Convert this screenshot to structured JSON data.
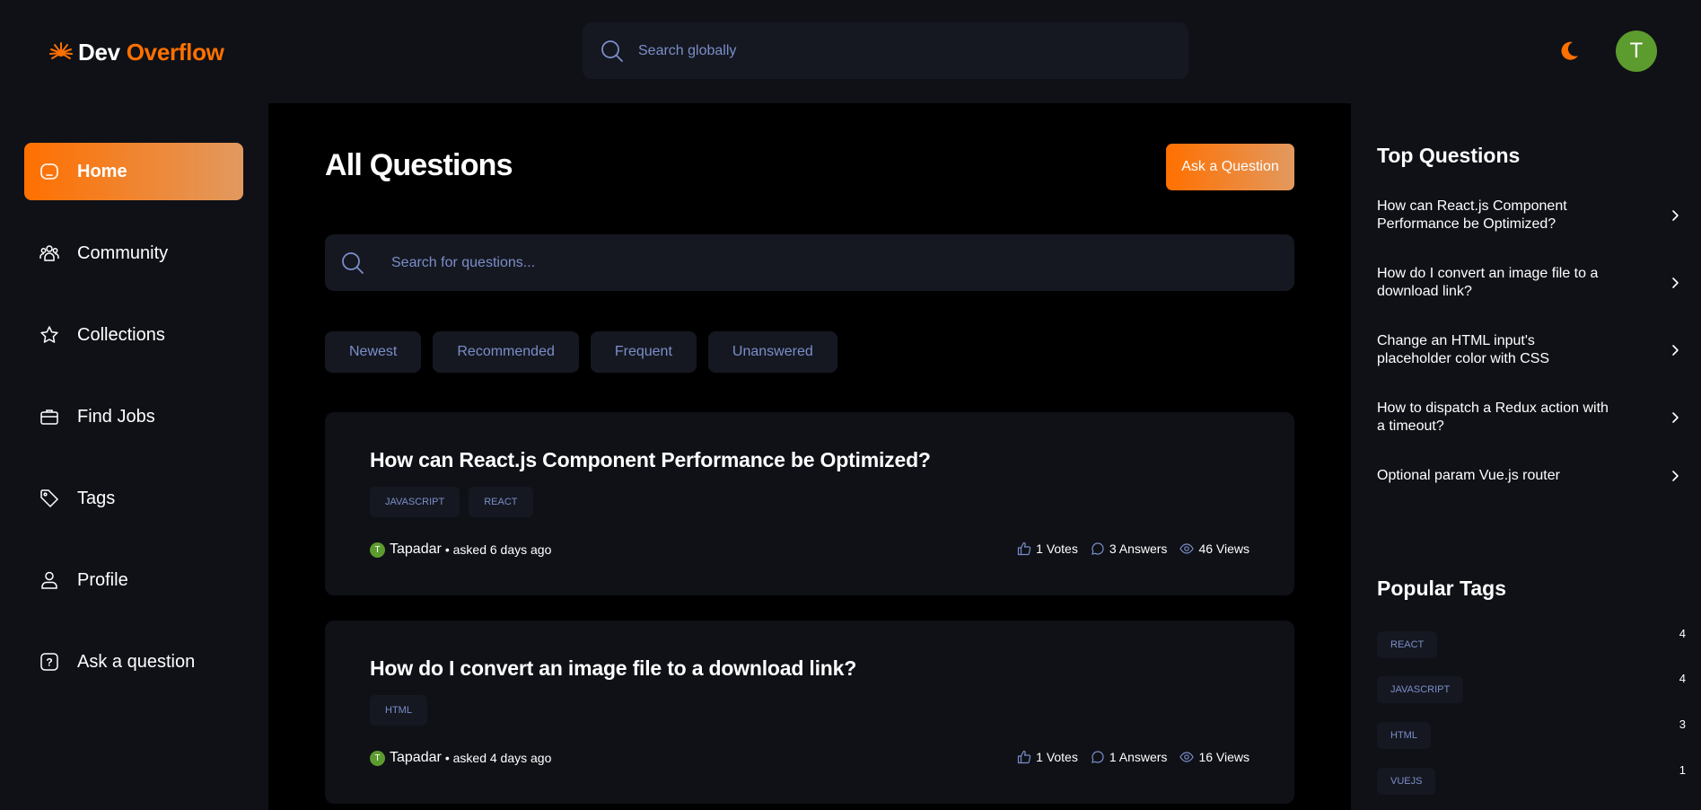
{
  "app": {
    "logo_word1": "Dev",
    "logo_word2": "Overflow",
    "accent_color": "#ff7000",
    "search_placeholder": "Search globally",
    "avatar_initial": "T",
    "theme_icon": "moon-icon"
  },
  "sidebar": {
    "items": [
      {
        "label": "Home",
        "icon": "home-icon",
        "active": true
      },
      {
        "label": "Community",
        "icon": "users-icon"
      },
      {
        "label": "Collections",
        "icon": "star-icon"
      },
      {
        "label": "Find Jobs",
        "icon": "briefcase-icon"
      },
      {
        "label": "Tags",
        "icon": "tag-icon"
      },
      {
        "label": "Profile",
        "icon": "user-icon"
      },
      {
        "label": "Ask a question",
        "icon": "question-icon"
      }
    ]
  },
  "main": {
    "title": "All Questions",
    "ask_button": "Ask a Question",
    "search_placeholder": "Search for questions...",
    "filters": [
      "Newest",
      "Recommended",
      "Frequent",
      "Unanswered"
    ],
    "questions": [
      {
        "title": "How can React.js Component Performance be Optimized?",
        "tags": [
          "JAVASCRIPT",
          "REACT"
        ],
        "author": "Tapadar",
        "author_initial": "T",
        "asked": "• asked 6 days ago",
        "votes": "1 Votes",
        "answers": "3 Answers",
        "views": "46 Views"
      },
      {
        "title": "How do I convert an image file to a download link?",
        "tags": [
          "HTML"
        ],
        "author": "Tapadar",
        "author_initial": "T",
        "asked": "• asked 4 days ago",
        "votes": "1 Votes",
        "answers": "1 Answers",
        "views": "16 Views"
      }
    ]
  },
  "rightbar": {
    "top_questions_title": "Top Questions",
    "top_questions": [
      "How can React.js Component Performance be Optimized?",
      "How do I convert an image file to a download link?",
      "Change an HTML input's placeholder color with CSS",
      "How to dispatch a Redux action with a timeout?",
      "Optional param Vue.js router"
    ],
    "popular_tags_title": "Popular Tags",
    "popular_tags": [
      {
        "name": "REACT",
        "count": "4"
      },
      {
        "name": "JAVASCRIPT",
        "count": "4"
      },
      {
        "name": "HTML",
        "count": "3"
      },
      {
        "name": "VUEJS",
        "count": "1"
      }
    ]
  }
}
